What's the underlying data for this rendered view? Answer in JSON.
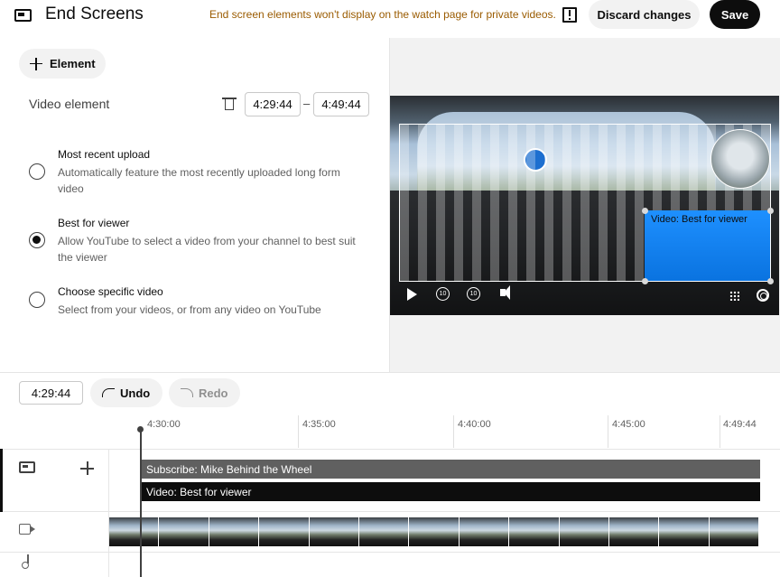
{
  "header": {
    "title": "End Screens",
    "notice": "End screen elements won't display on the watch page for private videos.",
    "discard_label": "Discard changes",
    "save_label": "Save"
  },
  "editor": {
    "add_element_label": "Element",
    "element_label": "Video element",
    "start_time": "4:29:44",
    "end_time": "4:49:44",
    "separator": "–",
    "options": [
      {
        "title": "Most recent upload",
        "description": "Automatically feature the most recently uploaded long form video",
        "selected": false
      },
      {
        "title": "Best for viewer",
        "description": "Allow YouTube to select a video from your channel to best suit the viewer",
        "selected": true
      },
      {
        "title": "Choose specific video",
        "description": "Select from your videos, or from any video on YouTube",
        "selected": false
      }
    ]
  },
  "preview": {
    "video_element_label": "Video: Best for viewer",
    "rewind_label": "10",
    "forward_label": "10",
    "accent_color": "#1e90ff"
  },
  "timeline": {
    "current_time": "4:29:44",
    "undo_label": "Undo",
    "redo_label": "Redo",
    "ruler": [
      "4:30:00",
      "4:35:00",
      "4:40:00",
      "4:45:00",
      "4:49:44"
    ],
    "tracks": {
      "subscribe_label": "Subscribe: Mike Behind the Wheel",
      "video_label": "Video: Best for viewer"
    }
  }
}
